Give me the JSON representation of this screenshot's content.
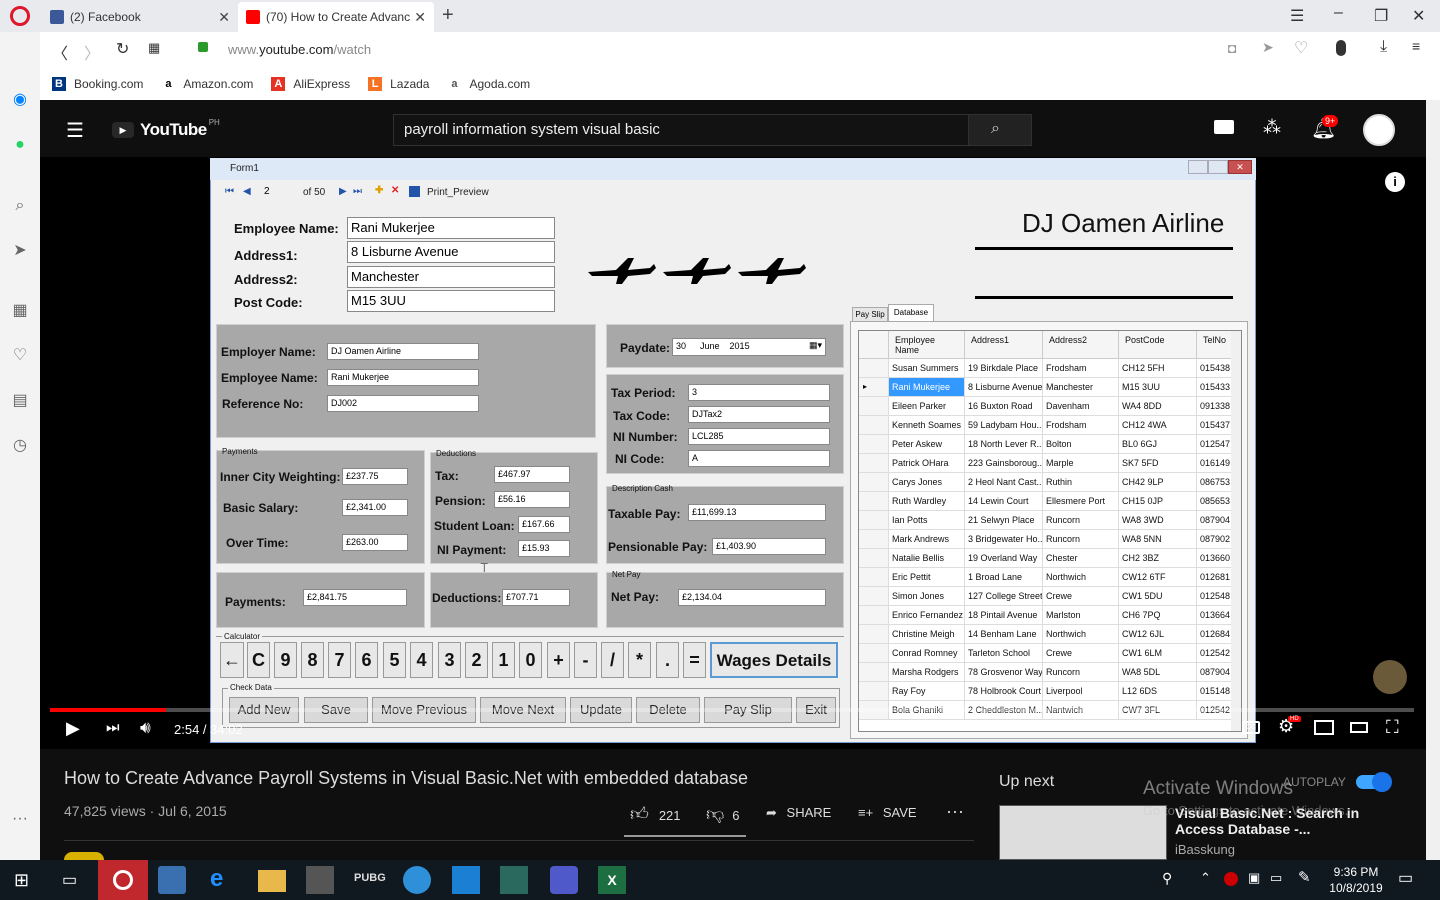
{
  "browser": {
    "tabs": [
      {
        "label": "(2) Facebook",
        "active": false,
        "icon_color": "#3b5998"
      },
      {
        "label": "(70) How to Create Advanc",
        "active": true,
        "icon_color": "#ff0000"
      }
    ],
    "new_tab": "+",
    "url_prefix": "www.",
    "url_host": "youtube.com",
    "url_path": "/watch",
    "bookmarks": [
      {
        "label": "Booking.com",
        "icon": "B",
        "color": "#003580"
      },
      {
        "label": "Amazon.com",
        "icon": "a",
        "color": "#000"
      },
      {
        "label": "AliExpress",
        "icon": "A",
        "color": "#e43225"
      },
      {
        "label": "Lazada",
        "icon": "L",
        "color": "#f57224"
      },
      {
        "label": "Agoda.com",
        "icon": "a",
        "color": "#555"
      }
    ]
  },
  "youtube": {
    "logo": "YouTube",
    "logo_region": "PH",
    "search_query": "payroll information system visual basic",
    "notification_count": "9+",
    "video_title": "How to Create Advance Payroll Systems in Visual Basic.Net with embedded database",
    "views": "47,825 views",
    "date": "Jul 6, 2015",
    "likes": "221",
    "dislikes": "6",
    "share": "SHARE",
    "save": "SAVE",
    "time_current": "2:54",
    "time_total": "34:02",
    "progress": 0.085,
    "up_next": "Up next",
    "autoplay": "AUTOPLAY",
    "next_title": "Visual Basic.Net : Search in Access Database -...",
    "next_channel": "iBasskung",
    "activate_title": "Activate Windows",
    "activate_sub": "Go to Settings to activate Windows."
  },
  "form": {
    "title": "Form1",
    "nav_position": "2",
    "nav_total": "of 50",
    "print_preview": "Print_Preview",
    "company": "DJ Oamen Airline",
    "labels": {
      "employee_name": "Employee Name:",
      "address1": "Address1:",
      "address2": "Address2:",
      "post_code": "Post Code:"
    },
    "values": {
      "employee_name": "Rani Mukerjee",
      "address1": "8 Lisburne Avenue",
      "address2": "Manchester",
      "post_code": "M15 3UU"
    },
    "employer": {
      "employer_label": "Employer Name:",
      "employer_value": "DJ Oamen Airline",
      "employee_label": "Employee Name:",
      "employee_value": "Rani Mukerjee",
      "ref_label": "Reference No:",
      "ref_value": "DJ002"
    },
    "paydate": {
      "label": "Paydate:",
      "day": "30",
      "month": "June",
      "year": "2015"
    },
    "tax": {
      "period_label": "Tax Period:",
      "period_value": "3",
      "code_label": "Tax Code:",
      "code_value": "DJTax2",
      "ni_label": "NI Number:",
      "ni_value": "LCL285",
      "nicode_label": "NI Code:",
      "nicode_value": "A"
    },
    "payments": {
      "caption": "Payments",
      "inner_label": "Inner City Weighting:",
      "inner_value": "£237.75",
      "basic_label": "Basic Salary:",
      "basic_value": "£2,341.00",
      "over_label": "Over Time:",
      "over_value": "£263.00",
      "total_label": "Payments:",
      "total_value": "£2,841.75"
    },
    "deductions": {
      "caption": "Deductions",
      "tax_label": "Tax:",
      "tax_value": "£467.97",
      "pension_label": "Pension:",
      "pension_value": "£56.16",
      "loan_label": "Student Loan:",
      "loan_value": "£167.66",
      "ni_label": "NI Payment:",
      "ni_value": "£15.93",
      "total_label": "Deductions:",
      "total_value": "£707.71"
    },
    "cash": {
      "caption": "Description Cash",
      "taxable_label": "Taxable Pay:",
      "taxable_value": "£11,699.13",
      "pensionable_label": "Pensionable Pay:",
      "pensionable_value": "£1,403.90"
    },
    "netpay": {
      "caption": "Net Pay",
      "label": "Net Pay:",
      "value": "£2,134.04"
    },
    "calculator_caption": "Calculator",
    "calc_keys": [
      "←",
      "C",
      "9",
      "8",
      "7",
      "6",
      "5",
      "4",
      "3",
      "2",
      "1",
      "0",
      "+",
      "-",
      "/",
      "*",
      ".",
      "="
    ],
    "wages_button": "Wages Details",
    "checkdata_caption": "Check Data",
    "buttons": [
      "Add New",
      "Save",
      "Move Previous",
      "Move Next",
      "Update",
      "Delete",
      "Pay Slip",
      "Exit"
    ],
    "tabs": [
      "Pay Slip",
      "Database"
    ],
    "grid_headers": [
      "Employee Name",
      "Address1",
      "Address2",
      "PostCode",
      "TelNo"
    ],
    "grid_rows": [
      [
        "Susan Summers",
        "19 Birkdale Place",
        "Frodsham",
        "CH12 5FH",
        "015438"
      ],
      [
        "Rani Mukerjee",
        "8 Lisburne Avenue",
        "Manchester",
        "M15 3UU",
        "015433"
      ],
      [
        "Eileen Parker",
        "16 Buxton Road",
        "Davenham",
        "WA4 8DD",
        "091338"
      ],
      [
        "Kenneth Soames",
        "59 Ladybam Hou...",
        "Frodsham",
        "CH12 4WA",
        "015437"
      ],
      [
        "Peter Askew",
        "18 North Lever R...",
        "Bolton",
        "BL0 6GJ",
        "012547"
      ],
      [
        "Patrick OHara",
        "223 Gainsboroug...",
        "Marple",
        "SK7 5FD",
        "016149"
      ],
      [
        "Carys Jones",
        "2 Heol Nant Cast...",
        "Ruthin",
        "CH42 9LP",
        "086753"
      ],
      [
        "Ruth Wardley",
        "14 Lewin Court",
        "Ellesmere Port",
        "CH15 0JP",
        "085653"
      ],
      [
        "Ian Potts",
        "21 Selwyn Place",
        "Runcorn",
        "WA8 3WD",
        "087904"
      ],
      [
        "Mark Andrews",
        "3 Bridgewater Ho...",
        "Runcorn",
        "WA8 5NN",
        "087902"
      ],
      [
        "Natalie Bellis",
        "19 Overland Way",
        "Chester",
        "CH2 3BZ",
        "013660"
      ],
      [
        "Eric Pettit",
        "1 Broad Lane",
        "Northwich",
        "CW12 6TF",
        "012681"
      ],
      [
        "Simon Jones",
        "127 College Street",
        "Crewe",
        "CW1 5DU",
        "012548"
      ],
      [
        "Enrico Fernandez",
        "18 Pintail Avenue",
        "Marlston",
        "CH6 7PQ",
        "013664"
      ],
      [
        "Christine Meigh",
        "14 Benham Lane",
        "Northwich",
        "CW12 6JL",
        "012684"
      ],
      [
        "Conrad Romney",
        "Tarleton School",
        "Crewe",
        "CW1 6LM",
        "012542"
      ],
      [
        "Marsha Rodgers",
        "78 Grosvenor Way",
        "Runcorn",
        "WA8 5DL",
        "087904"
      ],
      [
        "Ray Foy",
        "78 Holbrook Court",
        "Liverpool",
        "L12 6DS",
        "015148"
      ],
      [
        "Bola Ghaniki",
        "2 Cheddleston M...",
        "Nantwich",
        "CW7 3FL",
        "012542"
      ]
    ]
  },
  "taskbar": {
    "time": "9:36 PM",
    "date": "10/8/2019"
  }
}
